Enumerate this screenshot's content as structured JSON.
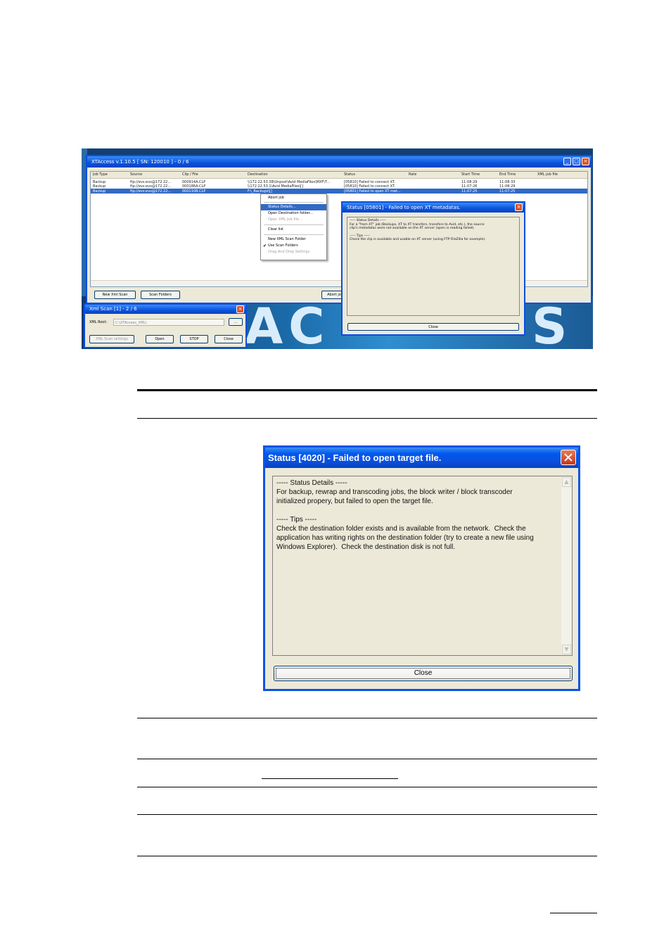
{
  "xtaccess": {
    "title": "XTAccess v.1.10.5 [ SN: 120010 ] - 0 / 6",
    "columns": [
      "Job Type",
      "Source",
      "Clip / File",
      "Destination",
      "Status",
      "Rate",
      "Start Time",
      "End Time",
      "XML job file"
    ],
    "rows": [
      [
        "Backup",
        "ftp://evs:evs@172.22...",
        "000914A.CLP",
        "\\\\172.22.53.38\\Unpost\\Avid MediaFiles\\MXF\\T...",
        "[05810] Failed to connect XT.",
        "",
        "11:08:29",
        "11:08:33",
        ""
      ],
      [
        "Backup",
        "ftp://evs:evs@172.22...",
        "000186A.CLP",
        "\\\\172.22.53.1\\Avid MediaFiles\\[]",
        "[05810] Failed to connect XT.",
        "",
        "11:07:26",
        "11:08:29",
        ""
      ],
      [
        "Backup",
        "ftp://evs:evs@172.22...",
        "000110B.CLP",
        "F:\\_Backups\\[]",
        "[05801] Failed to open XT met...",
        "",
        "11:07:25",
        "11:07:25",
        ""
      ]
    ],
    "buttons": {
      "new_xml_scan": "New Xml Scan",
      "scan_folders": "Scan Folders",
      "abort": "Abort jo"
    },
    "context_menu": {
      "abort_job": "Abort job",
      "status_details": "Status Details...",
      "open_destination": "Open Destination folder...",
      "open_xml": "Open XML Job file...",
      "clear_list": "Clear list",
      "new_xml_scan_folder": "New XML Scan Folder",
      "use_scan_folders": "Use Scan Folders",
      "drag_drop": "Drag And Drop Settings"
    }
  },
  "xml_scan": {
    "title": "Xml Scan [1] - 2 / 6",
    "root_label": "XML Root:",
    "root_value": "C:\\XTAccess_XML\\",
    "browse": "...",
    "settings": "XML Scan settings",
    "open": "Open",
    "stop": "STOP",
    "close": "Close"
  },
  "small_status": {
    "title": "Status [05801] - Failed to open XT metadatas.",
    "lines": [
      "----- Status Details -----",
      "For a \"from XT\" job (Backups, XT to XT transfers, transfers to Avid, etc.), the source",
      "clip's metadatas were not available on the XT server (open in reading failed).",
      "",
      "----- Tips -----",
      "Check the clip is available and usable on XT server  (using FTP FileZilla for example)."
    ],
    "close": "Close"
  },
  "status_dialog": {
    "title": "Status [4020] - Failed to open target file.",
    "lines": [
      "----- Status Details -----",
      "For backup, rewrap and transcoding jobs, the block writer / block transcoder",
      "initialized propery, but failed to open the target file.",
      "",
      "----- Tips -----",
      "Check the destination folder exists and is available from the network.  Check the",
      "application has writing rights on the destination folder (try to create a new file using",
      "Windows Explorer).  Check the destination disk is not full."
    ],
    "close": "Close"
  }
}
